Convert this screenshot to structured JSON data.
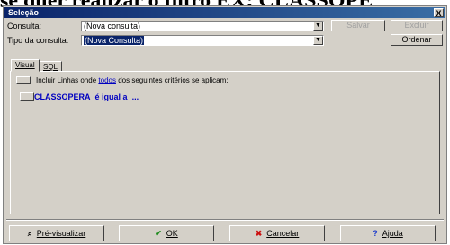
{
  "caption_text": "se quer realizar o filtro EX: CLASSOPE",
  "window": {
    "title": "Seleção",
    "close_label": "X"
  },
  "form": {
    "consulta_label": "Consulta:",
    "consulta_value": "(Nova consulta)",
    "tipo_label": "Tipo da consulta:",
    "tipo_value": "(Nova Consulta)",
    "salvar_label": "Salvar",
    "excluir_label": "Excluir",
    "ordenar_label": "Ordenar"
  },
  "tabs": [
    {
      "label": "Visual",
      "active": true
    },
    {
      "label": "SQL",
      "active": false
    }
  ],
  "criteria": {
    "intro_prefix": "Incluir Linhas onde ",
    "intro_link": "todos",
    "intro_suffix": " dos seguintes critérios se aplicam:",
    "field": "CLASSOPERA",
    "operator": "é igual a",
    "value": "..."
  },
  "footer": {
    "preview_label": "Pré-visualizar",
    "ok_label": "OK",
    "cancel_label": "Cancelar",
    "help_label": "Ajuda"
  },
  "icons": {
    "preview": "magnifier-icon",
    "ok": "checkmark-icon",
    "cancel": "red-x-icon",
    "help": "question-mark-icon"
  },
  "colors": {
    "title_bar": "#0a246a",
    "selection": "#0a246a",
    "link": "#0000c0",
    "ok_check": "#1a8a1a",
    "cancel_x": "#cc1111",
    "help_q": "#1a3acc"
  }
}
